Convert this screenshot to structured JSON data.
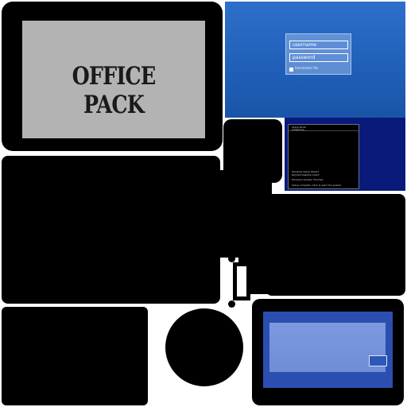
{
  "colors": {
    "background": "#ffffff",
    "frame": "#000000",
    "office_screen": "#b3b3b3",
    "login_blue": "#2d6fcb",
    "console_blue": "#0a1a7a",
    "desktop_blue": "#6f8cd6"
  },
  "office_monitor": {
    "title": "OFFICE PACK"
  },
  "login_screen": {
    "username_placeholder": "username",
    "password_placeholder": "password",
    "remember_label": "Remember Me"
  },
  "console_screen": {
    "lines": [
      "Setup Mode",
      "Initializing...",
      "Windows Setup Wizard",
      "Remote Desktop Client",
      "Windows Update: Finished",
      "Setup complete. Click to start the system."
    ]
  },
  "desktop_screen": {
    "mini_window": "",
    "footer_lines": [
      "",
      ""
    ]
  }
}
